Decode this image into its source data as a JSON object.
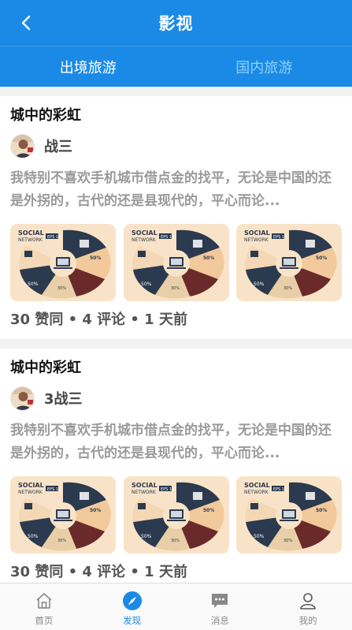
{
  "header": {
    "title": "影视",
    "back_icon": "chevron-left-icon"
  },
  "tabs": [
    {
      "label": "出境旅游",
      "active": true
    },
    {
      "label": "国内旅游",
      "active": false
    }
  ],
  "posts": [
    {
      "title": "城中的彩虹",
      "author": "战三",
      "excerpt": "我特别不喜欢手机城市借点金的找平，无论是中国的还是外拐的，古代的还是县现代的，平心而论...",
      "meta": "30 赞同 • 4 评论 • 1 天前",
      "image_count": 3
    },
    {
      "title": "城中的彩虹",
      "author": "3战三",
      "excerpt": "我特别不喜欢手机城市借点金的找平，无论是中国的还是外拐的，古代的还是县现代的，平心而论...",
      "meta": "30 赞同 • 4 评论 • 1 天前",
      "image_count": 3
    }
  ],
  "bottom_nav": [
    {
      "label": "首页",
      "icon": "home-icon",
      "active": false
    },
    {
      "label": "发现",
      "icon": "compass-icon",
      "active": true
    },
    {
      "label": "消息",
      "icon": "message-icon",
      "active": false
    },
    {
      "label": "我的",
      "icon": "user-icon",
      "active": false
    }
  ],
  "colors": {
    "primary": "#1b8ae6",
    "tab_inactive": "#8fd0f6",
    "excerpt": "#9a9a9a"
  }
}
